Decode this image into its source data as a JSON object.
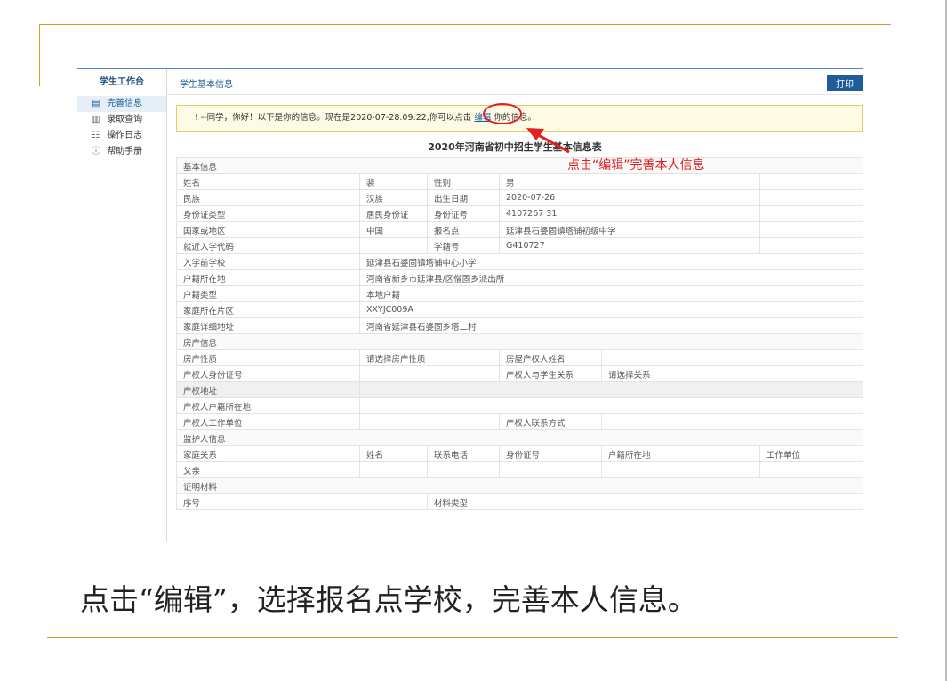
{
  "sidebar": {
    "title": "学生工作台",
    "items": [
      {
        "label": "完善信息",
        "icon": "id-card-icon",
        "active": true
      },
      {
        "label": "录取查询",
        "icon": "document-icon",
        "active": false
      },
      {
        "label": "操作日志",
        "icon": "log-icon",
        "active": false
      },
      {
        "label": "帮助手册",
        "icon": "info-icon",
        "active": false
      }
    ]
  },
  "header": {
    "breadcrumb": "学生基本信息",
    "print_label": "打印"
  },
  "notice": {
    "prefix": "!  --同学，你好！以下是你的信息。现在是2020-07-28.09:22,你可以点击",
    "link": "编辑",
    "suffix": "你的信息。"
  },
  "form": {
    "title": "2020年河南省初中招生学生基本信息表",
    "rows": [
      {
        "type": "section",
        "cells": [
          "基本信息"
        ]
      },
      {
        "type": "data",
        "cells": [
          "姓名",
          "裴",
          "性别",
          "男",
          ""
        ]
      },
      {
        "type": "data",
        "cells": [
          "民族",
          "汉族",
          "出生日期",
          "2020-07-26",
          ""
        ]
      },
      {
        "type": "data",
        "cells": [
          "身份证类型",
          "居民身份证",
          "身份证号",
          "4107267          31",
          ""
        ]
      },
      {
        "type": "data",
        "cells": [
          "国家或地区",
          "中国",
          "报名点",
          "延津县石婆固镇塔铺初级中学",
          ""
        ]
      },
      {
        "type": "data",
        "cells": [
          "就近入学代码",
          "",
          "学籍号",
          "G410727",
          ""
        ]
      },
      {
        "type": "wide",
        "cells": [
          "入学前学校",
          "延津县石婆固镇塔铺中心小学"
        ]
      },
      {
        "type": "wide",
        "cells": [
          "户籍所在地",
          "河南省新乡市延津县/区僧固乡派出所"
        ]
      },
      {
        "type": "wide",
        "cells": [
          "户籍类型",
          "本地户籍"
        ]
      },
      {
        "type": "wide",
        "cells": [
          "家庭所在片区",
          "XXYJC009A"
        ]
      },
      {
        "type": "wide",
        "cells": [
          "家庭详细地址",
          "河南省延津县石婆固乡塔二村"
        ]
      },
      {
        "type": "section",
        "cells": [
          "房产信息"
        ]
      },
      {
        "type": "prop",
        "cells": [
          "房产性质",
          "请选择房产性质",
          "房屋产权人姓名",
          ""
        ]
      },
      {
        "type": "prop",
        "cells": [
          "产权人身份证号",
          "",
          "产权人与学生关系",
          "请选择关系"
        ]
      },
      {
        "type": "graywide",
        "cells": [
          "产权地址",
          ""
        ]
      },
      {
        "type": "wide",
        "cells": [
          "产权人户籍所在地",
          ""
        ]
      },
      {
        "type": "prop",
        "cells": [
          "产权人工作单位",
          "",
          "产权人联系方式",
          ""
        ]
      },
      {
        "type": "section",
        "cells": [
          "监护人信息"
        ]
      },
      {
        "type": "guardian",
        "cells": [
          "家庭关系",
          "姓名",
          "联系电话",
          "身份证号",
          "户籍所在地",
          "工作单位"
        ]
      },
      {
        "type": "guardian",
        "cells": [
          "父亲",
          "",
          "",
          "",
          "",
          ""
        ]
      },
      {
        "type": "section",
        "cells": [
          "证明材料"
        ]
      },
      {
        "type": "material",
        "cells": [
          "序号",
          "材料类型"
        ]
      }
    ]
  },
  "annotation": {
    "text": "点击“编辑”完善本人信息",
    "color": "#e02020"
  },
  "caption": "点击“编辑”，选择报名点学校，完善本人信息。",
  "colors": {
    "accent": "#1f5c9c",
    "gold": "#c9a227",
    "notice_bg": "#fefbe5",
    "annotation": "#e02020"
  }
}
